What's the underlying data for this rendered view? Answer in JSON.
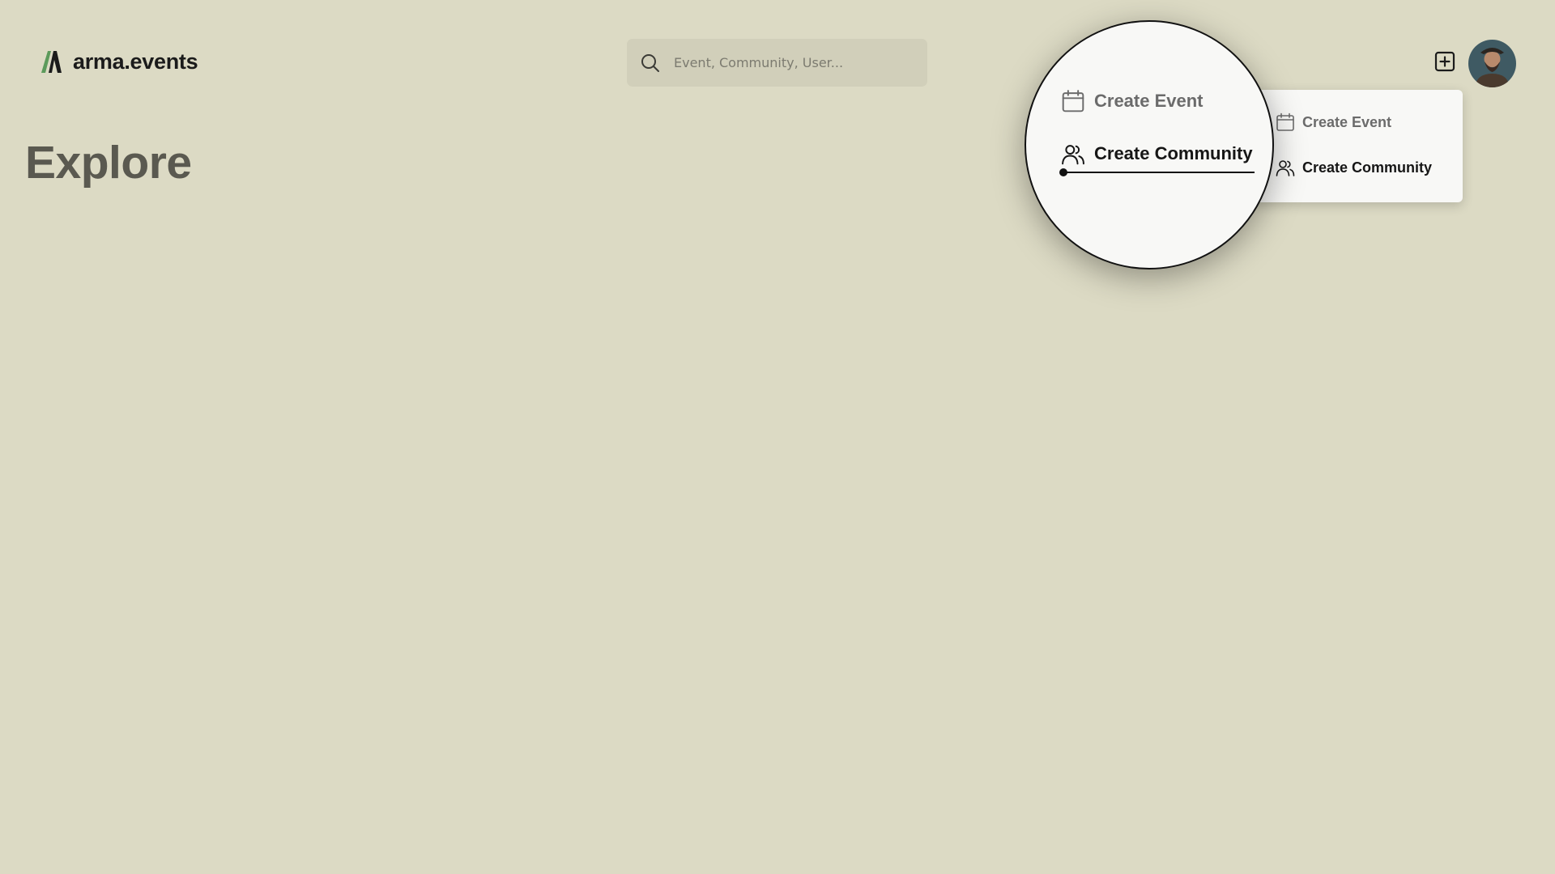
{
  "header": {
    "brand": "arma.events",
    "search_placeholder": "Event, Community, User..."
  },
  "main": {
    "title": "Explore"
  },
  "create_menu": {
    "items": [
      {
        "label": "Create Event",
        "icon": "calendar-icon"
      },
      {
        "label": "Create Community",
        "icon": "users-icon"
      }
    ],
    "highlighted_item": "Create Community"
  },
  "colors": {
    "background": "#dcdac4",
    "brand_green": "#5c9a5b",
    "menu_background": "#f8f8f6"
  }
}
